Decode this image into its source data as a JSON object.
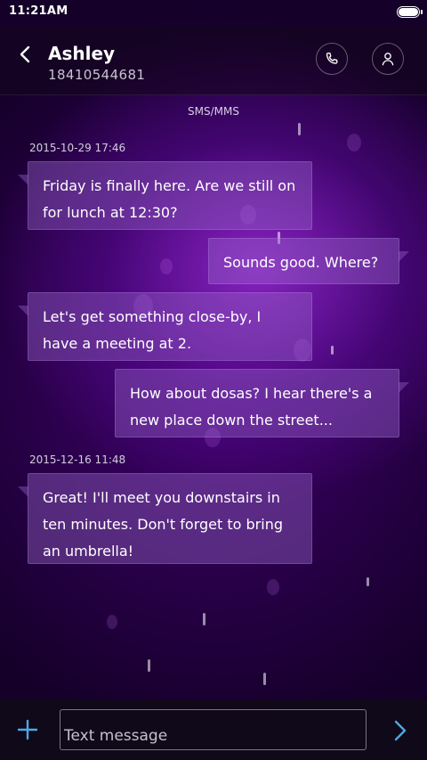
{
  "status_bar": {
    "time": "11:21AM",
    "battery_icon": "battery-icon"
  },
  "header": {
    "contact_name": "Ashley",
    "contact_number": "18410544681",
    "back_icon": "chevron-left-icon",
    "call_icon": "phone-icon",
    "profile_icon": "person-icon"
  },
  "thread": {
    "channel_label": "SMS/MMS",
    "timestamps": [
      "2015-10-29 17:46",
      "2015-12-16 11:48"
    ],
    "messages": [
      {
        "direction": "incoming",
        "text": "Friday is finally here. Are we still on for lunch at 12:30?"
      },
      {
        "direction": "outgoing",
        "text": "Sounds good. Where?"
      },
      {
        "direction": "incoming",
        "text": "Let's get something close-by, I have a meeting at 2."
      },
      {
        "direction": "outgoing",
        "text": "How about dosas? I hear there's a new place down the street..."
      },
      {
        "direction": "incoming",
        "text": "Great! I'll meet you downstairs in ten minutes. Don't forget to bring an umbrella!"
      }
    ]
  },
  "composer": {
    "placeholder": "Text message",
    "value": "",
    "attach_icon": "plus-icon",
    "send_icon": "send-arrow-icon"
  },
  "colors": {
    "accent": "#4aa8e8",
    "bubble": "#9664c8",
    "background": "#3a0a5e"
  }
}
